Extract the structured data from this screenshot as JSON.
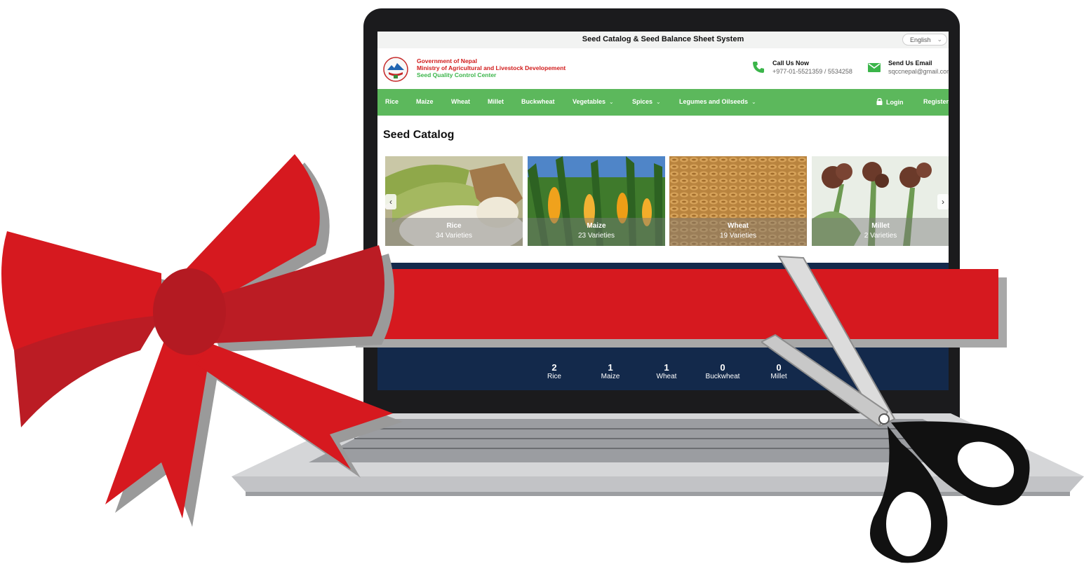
{
  "site": {
    "title": "Seed Catalog & Seed Balance Sheet System",
    "language": "English"
  },
  "header": {
    "gov_line1": "Government of Nepal",
    "gov_line2": "Ministry of Agricultural and Livestock Developement",
    "gov_line3": "Seed Quality Control Center",
    "call_title": "Call Us Now",
    "call_value": "+977-01-5521359 / 5534258",
    "email_title": "Send Us Email",
    "email_value": "sqccnepal@gmail.com"
  },
  "nav": {
    "items": [
      "Rice",
      "Maize",
      "Wheat",
      "Millet",
      "Buckwheat",
      "Vegetables",
      "Spices",
      "Legumes and Oilseeds"
    ],
    "login": "Login",
    "register": "Register"
  },
  "catalog": {
    "title": "Seed Catalog",
    "cards": [
      {
        "name": "Rice",
        "count": "34 Varieties"
      },
      {
        "name": "Maize",
        "count": "23 Varieties"
      },
      {
        "name": "Wheat",
        "count": "19 Varieties"
      },
      {
        "name": "Millet",
        "count": "2 Varieties"
      }
    ]
  },
  "stats": [
    {
      "value": "2",
      "label": "Rice"
    },
    {
      "value": "1",
      "label": "Maize"
    },
    {
      "value": "1",
      "label": "Wheat"
    },
    {
      "value": "0",
      "label": "Buckwheat"
    },
    {
      "value": "0",
      "label": "Millet"
    }
  ],
  "colors": {
    "nav_green": "#5cb85c",
    "ribbon_red": "#d6191f",
    "stats_navy": "#13294b",
    "gov_red": "#d11a1a",
    "gov_green": "#3bb54a"
  }
}
